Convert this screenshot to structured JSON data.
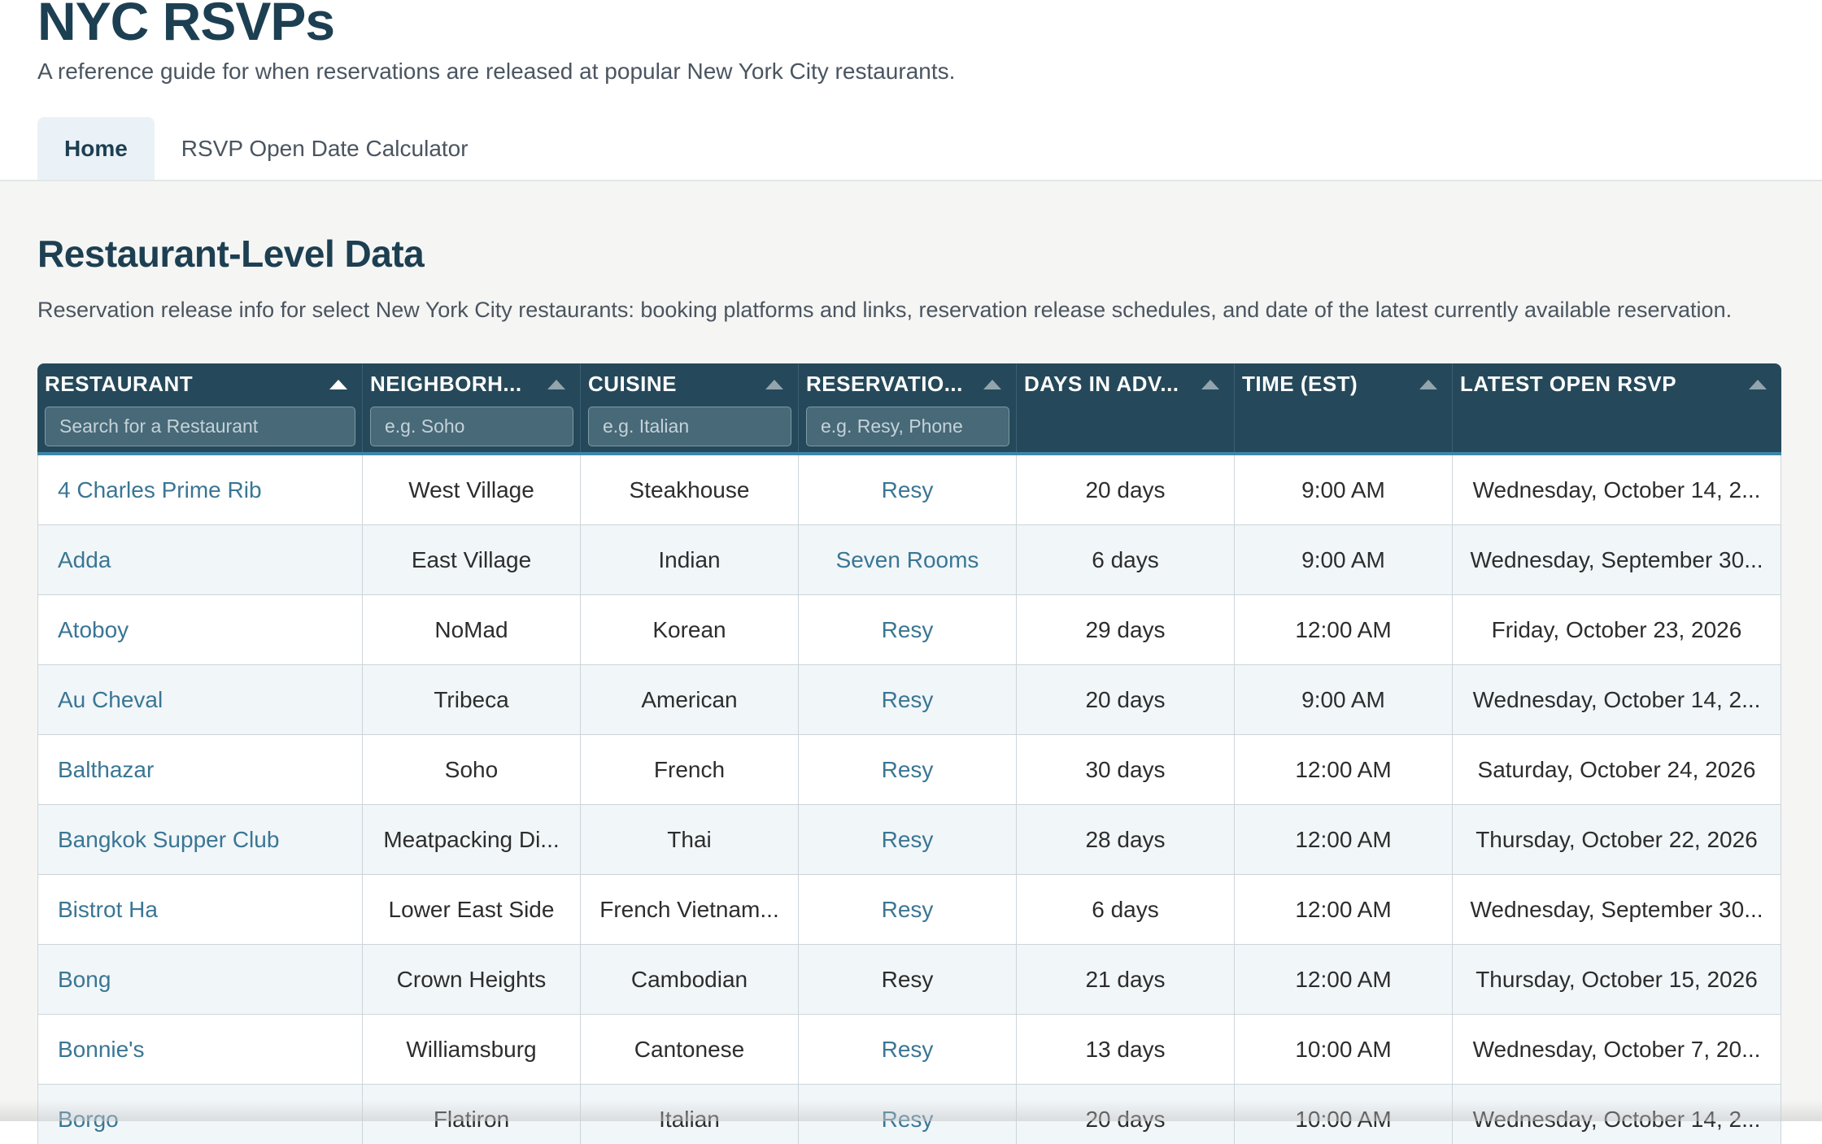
{
  "app": {
    "title": "NYC RSVPs",
    "subtitle": "A reference guide for when reservations are released at popular New York City restaurants."
  },
  "tabs": [
    {
      "label": "Home",
      "active": true
    },
    {
      "label": "RSVP Open Date Calculator",
      "active": false
    }
  ],
  "section": {
    "title": "Restaurant-Level Data",
    "description": "Reservation release info for select New York City restaurants: booking platforms and links, reservation release schedules, and date of the latest currently available reservation."
  },
  "table": {
    "columns": [
      {
        "label": "RESTAURANT",
        "placeholder": "Search for a Restaurant",
        "sorted": true
      },
      {
        "label": "NEIGHBORH...",
        "placeholder": "e.g. Soho",
        "sorted": false
      },
      {
        "label": "CUISINE",
        "placeholder": "e.g. Italian",
        "sorted": false
      },
      {
        "label": "RESERVATIO...",
        "placeholder": "e.g. Resy, Phone",
        "sorted": false
      },
      {
        "label": "DAYS IN ADV...",
        "placeholder": "",
        "sorted": false
      },
      {
        "label": "TIME (EST)",
        "placeholder": "",
        "sorted": false
      },
      {
        "label": "LATEST OPEN RSVP",
        "placeholder": "",
        "sorted": false
      }
    ],
    "rows": [
      {
        "restaurant": "4 Charles Prime Rib",
        "neighborhood": "West Village",
        "cuisine": "Steakhouse",
        "platform": "Resy",
        "platform_link": true,
        "days": "20 days",
        "time": "9:00 AM",
        "latest": "Wednesday, October 14, 2..."
      },
      {
        "restaurant": "Adda",
        "neighborhood": "East Village",
        "cuisine": "Indian",
        "platform": "Seven Rooms",
        "platform_link": true,
        "days": "6 days",
        "time": "9:00 AM",
        "latest": "Wednesday, September 30..."
      },
      {
        "restaurant": "Atoboy",
        "neighborhood": "NoMad",
        "cuisine": "Korean",
        "platform": "Resy",
        "platform_link": true,
        "days": "29 days",
        "time": "12:00 AM",
        "latest": "Friday, October 23, 2026"
      },
      {
        "restaurant": "Au Cheval",
        "neighborhood": "Tribeca",
        "cuisine": "American",
        "platform": "Resy",
        "platform_link": true,
        "days": "20 days",
        "time": "9:00 AM",
        "latest": "Wednesday, October 14, 2..."
      },
      {
        "restaurant": "Balthazar",
        "neighborhood": "Soho",
        "cuisine": "French",
        "platform": "Resy",
        "platform_link": true,
        "days": "30 days",
        "time": "12:00 AM",
        "latest": "Saturday, October 24, 2026"
      },
      {
        "restaurant": "Bangkok Supper Club",
        "neighborhood": "Meatpacking Di...",
        "cuisine": "Thai",
        "platform": "Resy",
        "platform_link": true,
        "days": "28 days",
        "time": "12:00 AM",
        "latest": "Thursday, October 22, 2026"
      },
      {
        "restaurant": "Bistrot Ha",
        "neighborhood": "Lower East Side",
        "cuisine": "French Vietnam...",
        "platform": "Resy",
        "platform_link": true,
        "days": "6 days",
        "time": "12:00 AM",
        "latest": "Wednesday, September 30..."
      },
      {
        "restaurant": "Bong",
        "neighborhood": "Crown Heights",
        "cuisine": "Cambodian",
        "platform": "Resy",
        "platform_link": false,
        "days": "21 days",
        "time": "12:00 AM",
        "latest": "Thursday, October 15, 2026"
      },
      {
        "restaurant": "Bonnie's",
        "neighborhood": "Williamsburg",
        "cuisine": "Cantonese",
        "platform": "Resy",
        "platform_link": true,
        "days": "13 days",
        "time": "10:00 AM",
        "latest": "Wednesday, October 7, 20..."
      },
      {
        "restaurant": "Borgo",
        "neighborhood": "Flatiron",
        "cuisine": "Italian",
        "platform": "Resy",
        "platform_link": true,
        "days": "20 days",
        "time": "10:00 AM",
        "latest": "Wednesday, October 14, 2..."
      }
    ]
  },
  "colors": {
    "header_bg": "#25495a",
    "accent": "#3f86a8",
    "link": "#3a7694",
    "title": "#1d3f52"
  }
}
